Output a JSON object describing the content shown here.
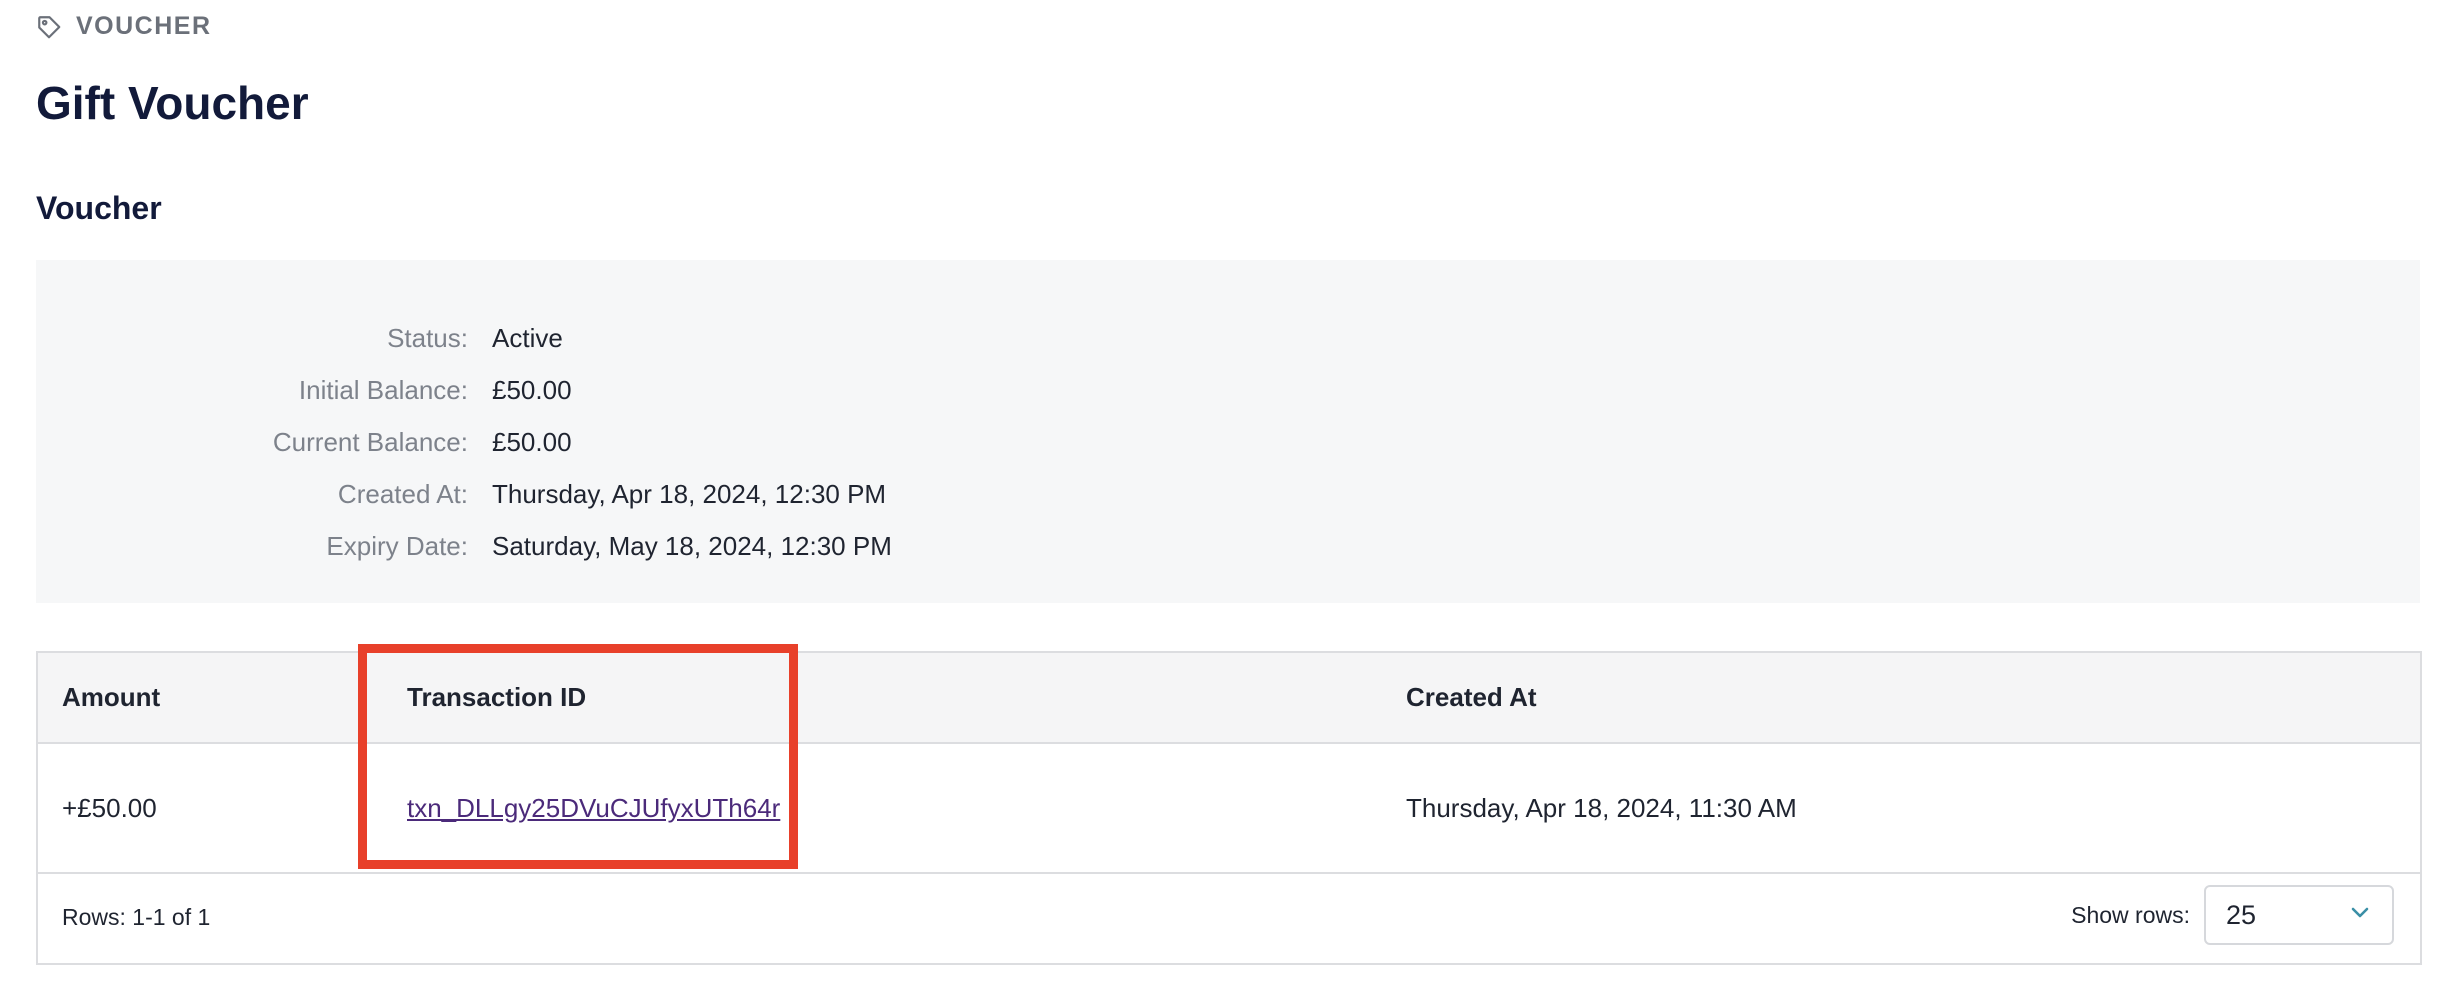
{
  "eyebrow": {
    "icon": "tag-icon",
    "label": "VOUCHER"
  },
  "page": {
    "title": "Gift Voucher"
  },
  "section": {
    "title": "Voucher"
  },
  "details": [
    {
      "label": "Status:",
      "value": "Active"
    },
    {
      "label": "Initial Balance:",
      "value": "£50.00"
    },
    {
      "label": "Current Balance:",
      "value": "£50.00"
    },
    {
      "label": "Created At:",
      "value": "Thursday, Apr 18, 2024, 12:30 PM"
    },
    {
      "label": "Expiry Date:",
      "value": "Saturday, May 18, 2024, 12:30 PM"
    }
  ],
  "table": {
    "columns": [
      "Amount",
      "Transaction ID",
      "Created At"
    ],
    "rows": [
      {
        "amount": "+£50.00",
        "transaction_id": "txn_DLLgy25DVuCJUfyxUTh64r",
        "created_at": "Thursday, Apr 18, 2024, 11:30 AM"
      }
    ],
    "footer": {
      "rows_info": "Rows: 1-1 of 1",
      "show_rows_label": "Show rows:",
      "rows_per_page": "25"
    }
  },
  "colors": {
    "highlight": "#e8402a",
    "link": "#4b2a7a",
    "title": "#121a3a"
  }
}
